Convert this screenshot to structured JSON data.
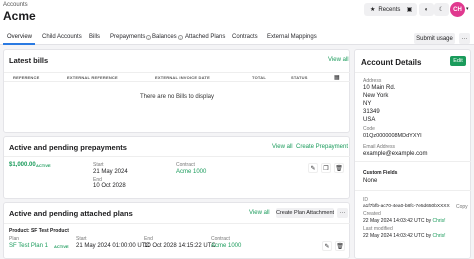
{
  "header": {
    "breadcrumb": "Accounts",
    "title": "Acme",
    "recents_label": "Recents",
    "avatar_initials": "CH"
  },
  "tabs": [
    {
      "label": "Overview"
    },
    {
      "label": "Child Accounts"
    },
    {
      "label": "Bills"
    },
    {
      "label": "Prepayments"
    },
    {
      "label": "Balances"
    },
    {
      "label": "Attached Plans"
    },
    {
      "label": "Contracts"
    },
    {
      "label": "External Mappings"
    }
  ],
  "toolbar": {
    "submit_label": "Submit usage",
    "more_label": "···"
  },
  "latest_bills": {
    "title": "Latest bills",
    "view_all": "View all",
    "columns": [
      "REFERENCE",
      "EXTERNAL REFERENCE",
      "EXTERNAL INVOICE DATE",
      "TOTAL",
      "STATUS"
    ],
    "empty_text": "There are no Bills to display"
  },
  "prepayments": {
    "title": "Active and pending prepayments",
    "view_all": "View all",
    "create_label": "Create Prepayment",
    "item": {
      "amount": "$1,000.00",
      "status": "ACTIVE",
      "start_label": "Start",
      "start_value": "21 May 2024",
      "end_label": "End",
      "end_value": "10 Oct 2028",
      "contract_label": "Contract",
      "contract_value": "Acme 1000"
    }
  },
  "attached_plans": {
    "title": "Active and pending attached plans",
    "view_all": "View all",
    "create_label": "Create Plan Attachment",
    "product_heading": "Product: SF Test Product",
    "item": {
      "plan_label": "Plan",
      "plan_value": "SF Test Plan 1",
      "start_label": "Start",
      "start_value": "21 May 2024 01:00:00 UTC",
      "end_label": "End",
      "end_value": "10 Oct 2028 14:15:22 UTC",
      "contract_label": "Contract",
      "contract_value": "Acme 1000"
    }
  },
  "account_details": {
    "title": "Account Details",
    "edit_label": "Edit",
    "address_label": "Address",
    "address_lines": [
      "10 Main Rd.",
      "New York",
      "NY",
      "31349",
      "USA"
    ],
    "code_label": "Code",
    "code_value": "01Qz0000008MDdYXYI",
    "email_label": "Email Address",
    "email_value": "example@example.com",
    "custom_fields_label": "Custom Fields",
    "custom_fields_value": "None",
    "id_label": "ID",
    "id_value": "a1f7bfb-ac70-4ea0-b8fc-7e5d650bXXXX",
    "copy_label": "Copy",
    "created_label": "Created",
    "created_value": "22 May 2024 14:03:42 UTC by",
    "created_by": "Chris!",
    "modified_label": "Last modified",
    "modified_value": "22 May 2024 14:03:42 UTC by",
    "modified_by": "Chris!"
  },
  "colors": {
    "accent": "#1a9b5b",
    "tab_active": "#2a7ae2",
    "avatar": "#e0398f"
  },
  "icons": [
    "star-icon",
    "gift-icon",
    "palette-icon",
    "moon-icon",
    "chevron-down-icon",
    "pencil-icon",
    "copy-icon",
    "trash-icon",
    "columns-icon",
    "info-icon"
  ]
}
